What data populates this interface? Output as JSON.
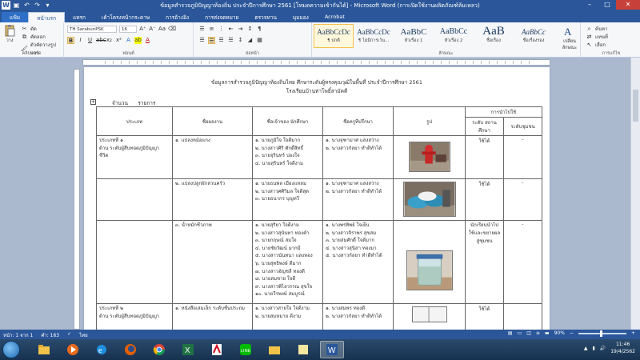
{
  "window": {
    "title": "ข้อมูลสำรวจภูมิปัญญาท้องถิ่น ประจำปีการศึกษา 2561 [โหมดความเข้ากันได้] - Microsoft Word (การเปิดใช้งานผลิตภัณฑ์ล้มเหลว)"
  },
  "ribbon_tabs": [
    "แฟ้ม",
    "หน้าแรก",
    "แทรก",
    "เค้าโครงหน้ากระดาษ",
    "การอ้างอิง",
    "การส่งจดหมาย",
    "ตรวจทาน",
    "มุมมอง",
    "Acrobat"
  ],
  "ribbon": {
    "paste": "วาง",
    "cut": "ตัด",
    "copy": "คัดลอก",
    "format_painter": "ตัวคัดวางรูปแบบ",
    "clipboard_label": "คลิปบอร์ด",
    "font_name": "TH SarabunPSK",
    "font_size": "16",
    "font_label": "ฟอนต์",
    "paragraph_label": "ย่อหน้า",
    "styles_label": "ลักษณะ",
    "change_styles": "เปลี่ยนลักษณะ",
    "find": "ค้นหา",
    "replace": "แทนที่",
    "select": "เลือก",
    "editing_label": "การแก้ไข",
    "styles": [
      {
        "preview": "AaBbCcDc",
        "name": "¶ ปกติ"
      },
      {
        "preview": "AaBbCcDc",
        "name": "¶ ไม่มีการเว้น..."
      },
      {
        "preview": "AaBbC",
        "name": "หัวเรื่อง 1"
      },
      {
        "preview": "AaBbCc",
        "name": "หัวเรื่อง 2"
      },
      {
        "preview": "AaB",
        "name": "ชื่อเรื่อง"
      },
      {
        "preview": "AaBbCc",
        "name": "ชื่อเรื่องรอง"
      },
      {
        "preview": "AaBbCcDc",
        "name": "ตัวเน้นแบบ..."
      }
    ]
  },
  "document": {
    "title": "ข้อมูลการสำรวจภูมิปัญญาท้องถิ่นไทย ศึกษาระดับผู้ทรงคุณวุฒิในพื้นที่ ประจำปีการศึกษา 2561",
    "subtitle": "โรงเรียนบ้านท่าโพธิ์สามัคคี",
    "count_label": "จำนวน",
    "count_value": "รายการ",
    "table": {
      "headers": {
        "category": "ประเภท",
        "name": "ชื่อผลงาน",
        "owner": "ชื่อเจ้าของ นักศึกษา",
        "person": "ชื่อครูที่ปรึกษา",
        "image": "รูป",
        "usage": "การนำไปใช้",
        "usage_school": "ระดับ สถานศึกษา",
        "usage_comm": "ระดับชุมชน"
      },
      "rows": [
        {
          "category": [
            "ประเภทที่ ๑",
            "ด้าน ระดับผู้สืบทอดภูมิปัญญา",
            "ชีวิต"
          ],
          "name": "๑. แปลงหม้อแกง",
          "owner": [
            "๑. นายภูมิใจ ใจดีมาก",
            "๒. นางสาวศิริ ศักดิ์สิทธิ์",
            "๓. นายจุรินทร์ ปองใจ",
            "๔. นายสุรินทร์ ใจดีงาม"
          ],
          "person": [
            "๑. นางจุฑามาศ แสงสว่าง",
            "๒. นางสาวกัลยา ทำดีทำได้"
          ],
          "usage_school": "ใช้ได้",
          "usage_comm": "-"
        },
        {
          "category": [],
          "name": "๒. แปลงปลูกผักสวนครัว",
          "owner": [
            "๑. นายธนพล เมืองแหลม",
            "๒. นางสาวศศิวิมล ใจดีสุด",
            "๓. นายธนากร บุญทวี"
          ],
          "person": [
            "๑. นางจุฑามาศ แสงสว่าง",
            "๒. นางสาวกัลยา ทำดีทำได้"
          ],
          "usage_school": "ใช้ได้",
          "usage_comm": "-"
        },
        {
          "category": [],
          "name": "๓. น้ำหมักชีวภาพ",
          "owner": [
            "๑. นายสุริยา ใจดีงาม",
            "๒. นางสาวสุนันทา ทองคำ",
            "๓. นายกฤษณ์ สมใจ",
            "๔. นายชัยวัฒน์ มากมี",
            "๕. นางสาวนันทนา แสงทอง",
            "๖. นายสุทธิพงษ์ ดีมาก",
            "๗. นางสาวอัญชลี ทองดี",
            "๘. นายสมชาย ใจดี",
            "๙. นางสาวพิไลวรรณ สุขใจ",
            "๑๐. นายวีรพงษ์ สมบูรณ์"
          ],
          "person": [
            "๑. นางพรทิพย์ ใจเย็น",
            "๒. นางสาวจิราพร สุขสม",
            "๓. นายสมศักดิ์ ใจดีมาก",
            "๔. นางสาวสุนิสา ทองมา",
            "๕. นางสาวกัลยา ทำดีทำได้"
          ],
          "usage_school": "นักเรียนนำไปใช้และขยายผลสู่ชุมชน",
          "usage_comm": "-"
        },
        {
          "category": [
            "ประเภทที่ ๒",
            "ด้าน ระดับผู้สืบทอดภูมิปัญญา"
          ],
          "name": "๑. หนังสือเล่มเล็ก ระดับชั้นประถม",
          "owner": [
            "๑. นางสาวสายใจ ใจดีงาม",
            "๒. นายสมหมาย ดีงาม"
          ],
          "person": [
            "๑. นางสมพร ทองดี",
            "๒. นางสาวกัลยา ทำดีทำได้"
          ],
          "usage_school": "ใช้ได้",
          "usage_comm": ""
        }
      ]
    }
  },
  "status": {
    "page": "หน้า: 1 จาก 1",
    "words": "คำ: 163",
    "language": "ไทย",
    "zoom": "90%"
  },
  "taskbar": {
    "time": "11:46",
    "date": "19/4/2562"
  },
  "colors": {
    "word_blue": "#2b579a",
    "page_bg": "#ffffff",
    "workspace": "#abb9cf",
    "close_red": "#c7403a"
  }
}
